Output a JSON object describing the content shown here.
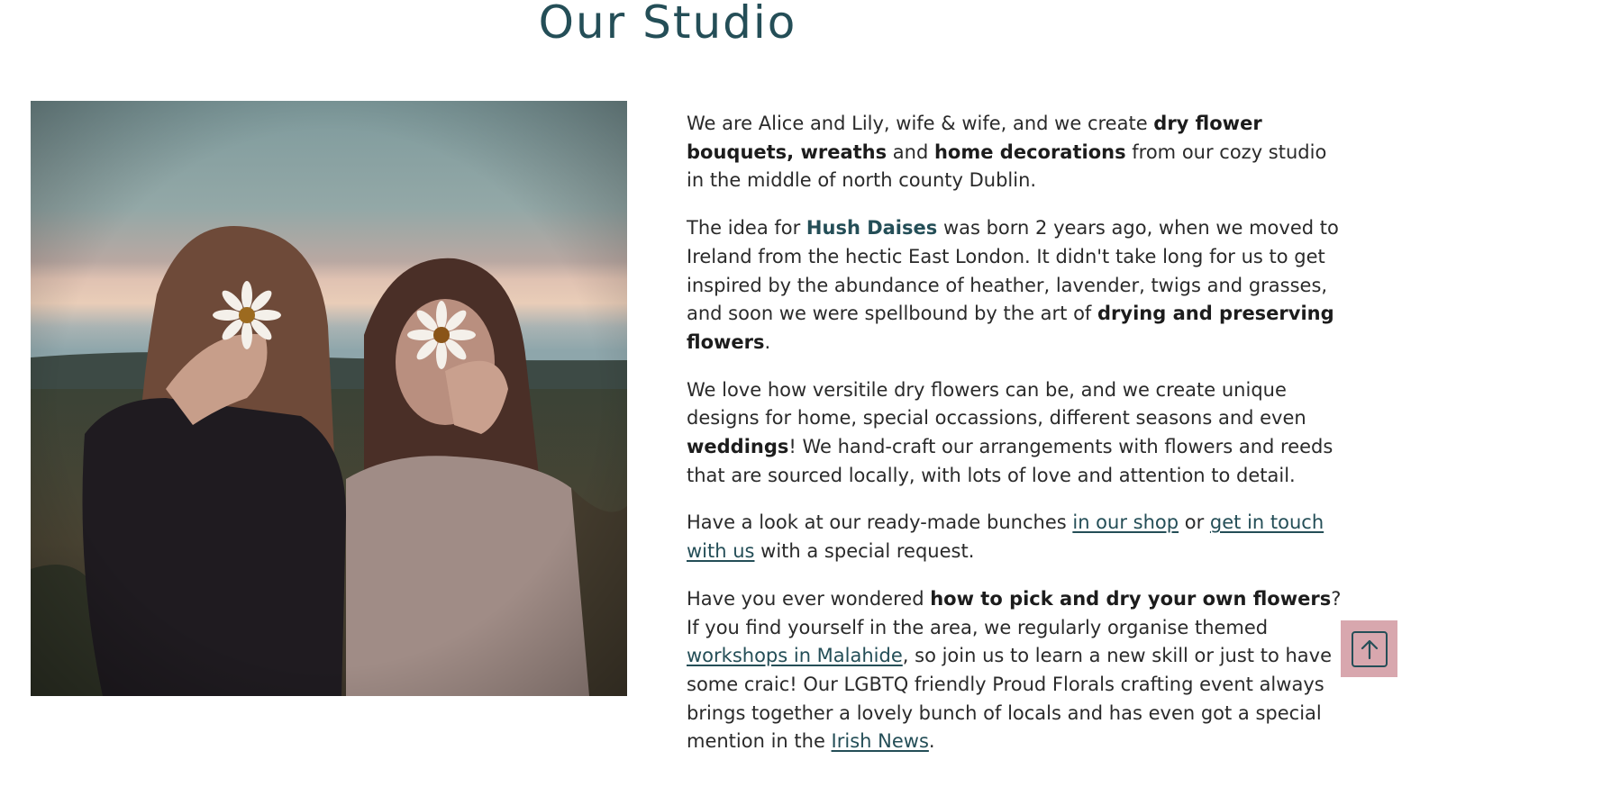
{
  "page": {
    "title": "Our Studio"
  },
  "image": {
    "subject": "two women holding daisies in front of their faces in a field at dusk"
  },
  "paragraphs": {
    "p1": {
      "t1": "We are Alice and Lily, wife & wife, and we create ",
      "b1": "dry flower bouquets, wreaths",
      "t2": " and ",
      "b2": "home decorations",
      "t3": " from our cozy studio in the middle of north county Dublin."
    },
    "p2": {
      "t1": "The idea for ",
      "brand": "Hush Daises",
      "t2": " was born 2 years ago, when we moved to Ireland from the hectic East London. It didn't take long for us to get inspired by the abundance of heather, lavender, twigs and grasses, and soon we were spellbound by the art of ",
      "b1": "drying and preserving flowers",
      "t3": "."
    },
    "p3": {
      "t1": "We love how versitile dry flowers can be, and we create unique designs for home, special occassions, different seasons and even ",
      "b1": "weddings",
      "t2": "! We hand-craft our arrangements with flowers and reeds that are sourced locally, with lots of love and attention to detail."
    },
    "p4": {
      "t1": "Have a look at our ready-made bunches ",
      "link1": "in our shop",
      "t2": " or ",
      "link2": "get in touch with us",
      "t3": " with a special request."
    },
    "p5": {
      "t1": "Have you ever wondered ",
      "b1": "how to pick and dry your own flowers",
      "t2": "? If you find yourself in the area, we regularly organise themed ",
      "link1": "workshops in Malahide",
      "t3": ", so join us to learn a new skill or just to have some craic! Our LGBTQ friendly Proud Florals crafting event always brings together a lovely bunch of locals and has even got a special mention in the ",
      "link2": "Irish News",
      "t4": "."
    }
  },
  "back_to_top": {
    "icon": "arrow-up-icon"
  },
  "colors": {
    "title": "#244e57",
    "link": "#244e57",
    "body_text": "#2a2a2a",
    "back_to_top_bg": "#d8a7ae"
  }
}
